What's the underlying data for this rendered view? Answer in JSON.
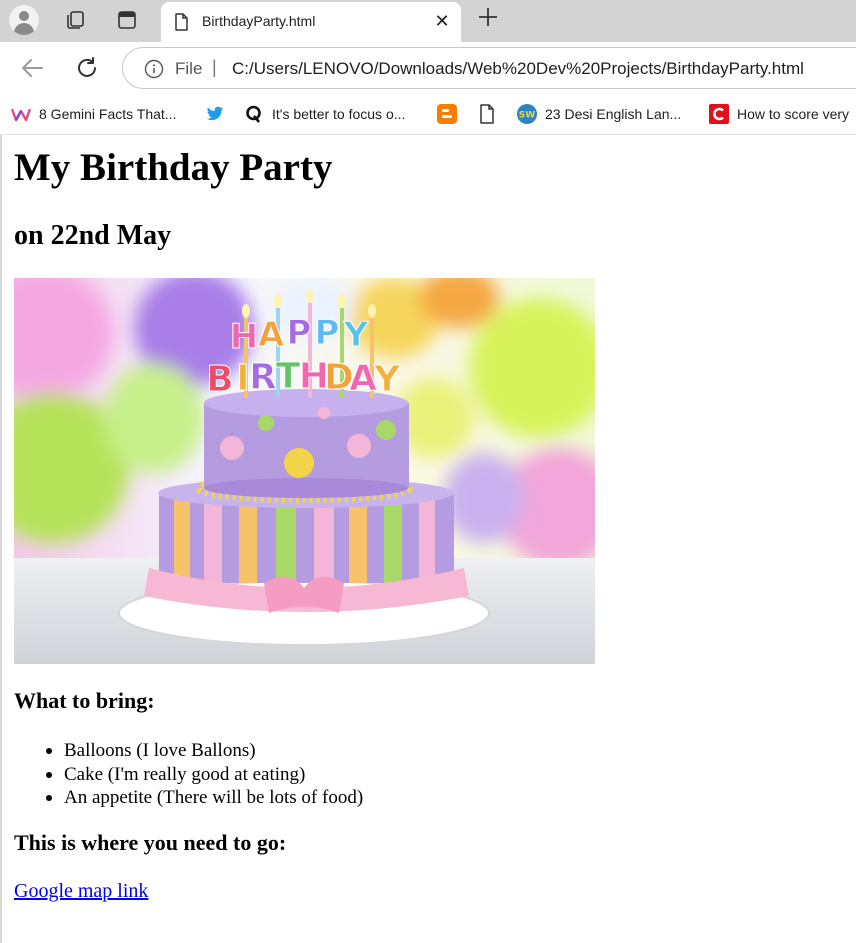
{
  "browser": {
    "tab": {
      "title": "BirthdayParty.html",
      "close_icon": "close-icon"
    },
    "address": {
      "scheme": "File",
      "separator": "|",
      "url": "C:/Users/LENOVO/Downloads/Web%20Dev%20Projects/BirthdayParty.html"
    },
    "bookmarks": [
      {
        "label": "8 Gemini Facts That...",
        "icon": "w-logo-icon"
      },
      {
        "label": "",
        "icon": "twitter-icon"
      },
      {
        "label": "It's better to focus o...",
        "icon": "quora-icon"
      },
      {
        "label": "",
        "icon": "blogger-icon"
      },
      {
        "label": "",
        "icon": "page-icon"
      },
      {
        "label": "23 Desi English Lan...",
        "icon": "sw-icon"
      },
      {
        "label": "How to score very",
        "icon": "c-logo-icon"
      }
    ],
    "colors": {
      "tabstrip": "#d3d3d3",
      "link": "#0000ee",
      "blogger": "#f57d00",
      "twitter": "#1d9bf0",
      "c_logo": "#e0101a"
    }
  },
  "page": {
    "heading": "My Birthday Party",
    "date_heading": "on 22nd May",
    "image": {
      "icon": "birthday-cake-image",
      "cake_topper": "HAPPY BIRTHDAY"
    },
    "bring_heading": "What to bring:",
    "bring_items": [
      "Balloons (I love Ballons)",
      "Cake (I'm really good at eating)",
      "An appetite (There will be lots of food)"
    ],
    "where_heading": "This is where you need to go:",
    "map_link": "Google map link"
  }
}
